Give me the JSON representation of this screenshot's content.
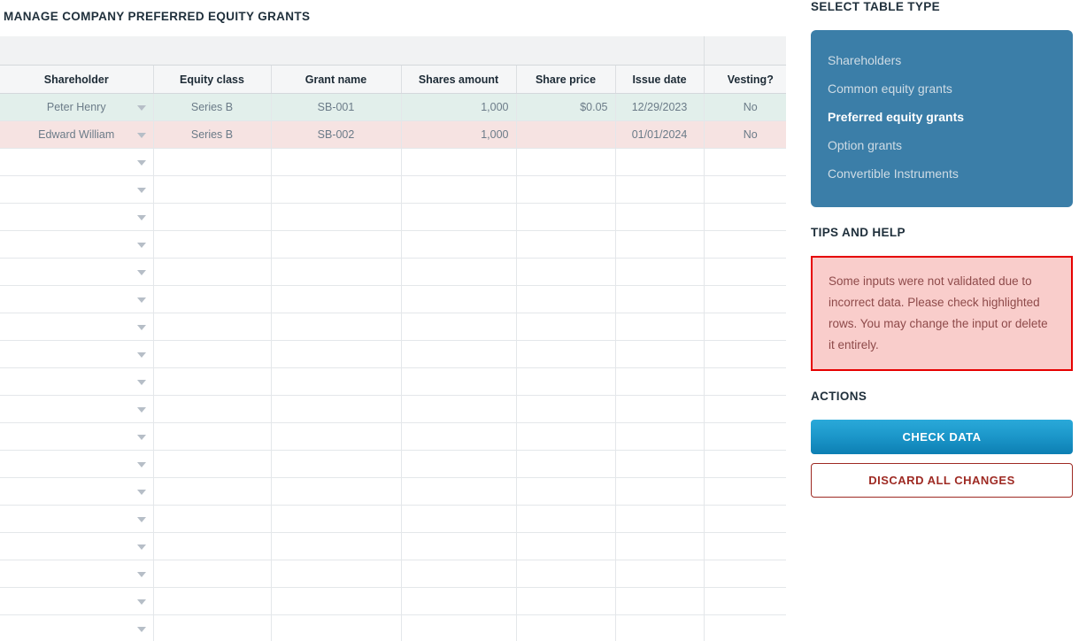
{
  "page": {
    "title": "MANAGE COMPANY PREFERRED EQUITY GRANTS"
  },
  "table": {
    "columns": [
      {
        "key": "shareholder",
        "label": "Shareholder",
        "align": "center"
      },
      {
        "key": "equity_class",
        "label": "Equity class",
        "align": "center"
      },
      {
        "key": "grant_name",
        "label": "Grant name",
        "align": "center"
      },
      {
        "key": "shares_amount",
        "label": "Shares amount",
        "align": "right"
      },
      {
        "key": "share_price",
        "label": "Share price",
        "align": "right"
      },
      {
        "key": "issue_date",
        "label": "Issue date",
        "align": "center"
      },
      {
        "key": "vesting",
        "label": "Vesting?",
        "align": "center"
      }
    ],
    "rows": [
      {
        "status": "ok",
        "shareholder": "Peter Henry",
        "equity_class": "Series B",
        "grant_name": "SB-001",
        "shares_amount": "1,000",
        "share_price": "$0.05",
        "issue_date": "12/29/2023",
        "vesting": "No"
      },
      {
        "status": "error",
        "shareholder": "Edward William",
        "equity_class": "Series B",
        "grant_name": "SB-002",
        "shares_amount": "1,000",
        "share_price": "",
        "issue_date": "01/01/2024",
        "vesting": "No"
      }
    ],
    "empty_row_count": 18,
    "dropdown_icon": "chevron-down-icon"
  },
  "rail": {
    "table_type": {
      "heading": "SELECT TABLE TYPE",
      "items": [
        {
          "label": "Shareholders",
          "active": false
        },
        {
          "label": "Common equity grants",
          "active": false
        },
        {
          "label": "Preferred equity grants",
          "active": true
        },
        {
          "label": "Option grants",
          "active": false
        },
        {
          "label": "Convertible Instruments",
          "active": false
        }
      ]
    },
    "tips": {
      "heading": "TIPS AND HELP",
      "message": "Some inputs were not validated due to incorrect data. Please check highlighted rows. You may change the input or delete it entirely."
    },
    "actions": {
      "heading": "ACTIONS",
      "check_label": "CHECK DATA",
      "discard_label": "DISCARD ALL CHANGES"
    }
  },
  "colors": {
    "panel_blue": "#3b7ea8",
    "check_button_top": "#2aa9d9",
    "check_button_bottom": "#0d7fb3",
    "error_border": "#e60000",
    "error_fill": "#f9cdcb",
    "error_text": "#8e4a4a",
    "discard_text": "#9e2a23",
    "row_ok_fill": "#e2efeb",
    "row_error_fill": "#f6e3e2",
    "header_fill": "#f5f6f7",
    "band_fill": "#f1f2f3",
    "title_text": "#20303c"
  }
}
